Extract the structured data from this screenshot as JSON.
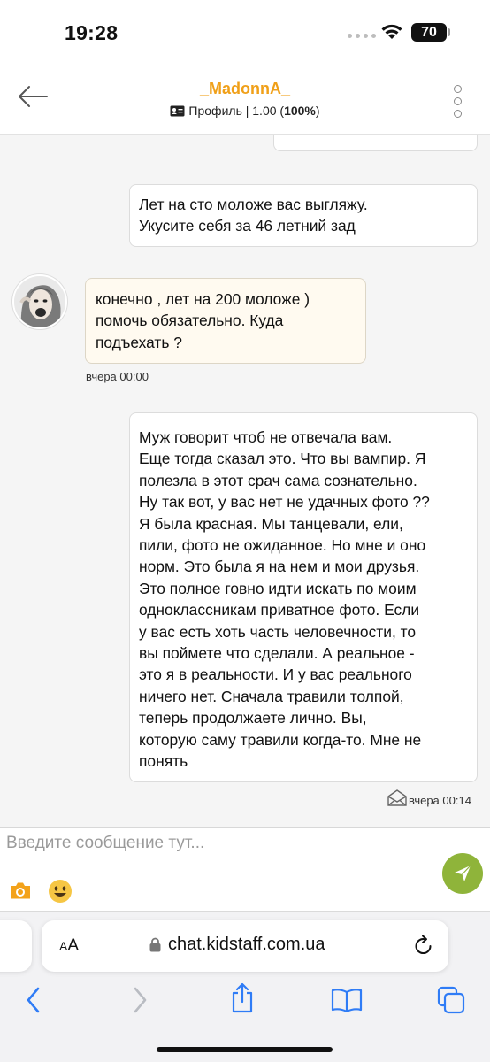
{
  "status_bar": {
    "time": "19:28",
    "battery": "70"
  },
  "header": {
    "title": "_MadonnA_",
    "subtitle_profile": "Профиль | 1.00 (",
    "subtitle_percent": "100%",
    "subtitle_close": ")"
  },
  "messages": [
    {
      "direction": "out",
      "text": "Лет на сто моложе вас выгляжу.\nУкусите себя за 46 летний зад"
    },
    {
      "direction": "in",
      "text": "конечно , лет на 200 моложе )\nпомочь обязательно. Куда\nподъехать ?",
      "time": "вчера 00:00"
    },
    {
      "direction": "out",
      "text": "Муж говорит чтоб не отвечала вам.\nЕще тогда сказал это. Что вы вампир. Я\nполезла в этот срач сама сознательно.\nНу так вот, у вас нет не удачных фото ??\nЯ была красная. Мы танцевали, ели,\nпили, фото не ожиданное. Но мне и оно\nнорм. Это была я на нем и мои друзья.\nЭто полное говно идти искать по моим\nодноклассникам приватное фото. Если\nу вас есть хоть часть человечности, то\nвы поймете что сделали. А реальное -\nэто я в реальности. И у вас реального\nничего нет. Сначала травили толпой,\nтеперь продолжаете лично. Вы,\nкоторую саму травили когда-то. Мне не\nпонять",
      "time": "вчера 00:14"
    }
  ],
  "composer": {
    "placeholder": "Введите сообщение тут..."
  },
  "browser": {
    "aa_label_small": "A",
    "aa_label_large": "A",
    "url": "chat.kidstaff.com.ua"
  },
  "colors": {
    "accent": "#f0a019",
    "send": "#8fb43a",
    "safari_blue": "#2f7cf6"
  }
}
